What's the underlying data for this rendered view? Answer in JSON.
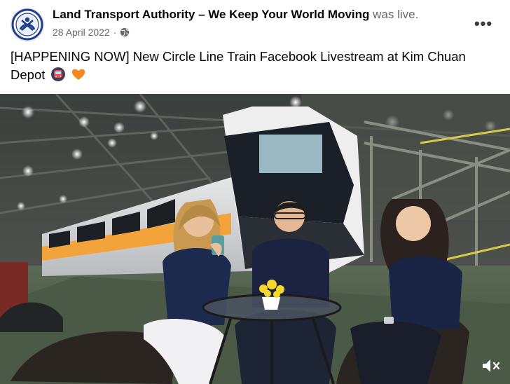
{
  "post": {
    "page_name": "Land Transport Authority – We Keep Your World Moving",
    "status": "was live.",
    "date": "28 April 2022",
    "separator": "·",
    "audience_icon": "globe-icon",
    "more_icon": "more-options-icon",
    "more_label": "•••",
    "text": "[HAPPENING NOW] New Circle Line Train Facebook Livestream at Kim Chuan Depot",
    "emojis": [
      "metro-train-emoji",
      "orange-heart-emoji"
    ]
  },
  "video": {
    "description_icon": "video-frame",
    "mute_icon": "speaker-muted-icon"
  },
  "colors": {
    "text_primary": "#050505",
    "text_secondary": "#65676b",
    "lta_blue": "#1f3f8c",
    "train_orange": "#f2a33a"
  }
}
